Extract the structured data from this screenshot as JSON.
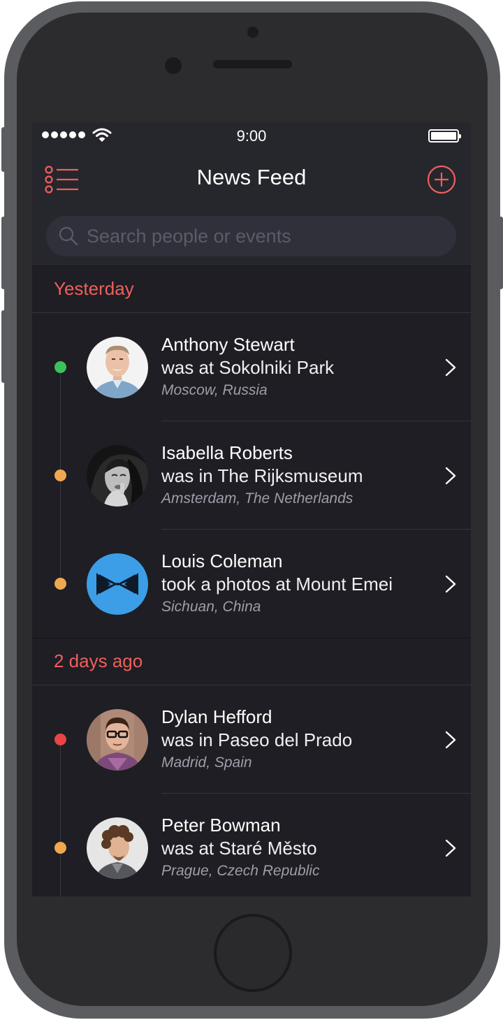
{
  "status_bar": {
    "time": "9:00"
  },
  "nav": {
    "title": "News Feed"
  },
  "search": {
    "placeholder": "Search people or events",
    "value": ""
  },
  "colors": {
    "accent": "#ef5f5c",
    "green": "#3cc25a",
    "orange": "#f0a850",
    "red": "#e84545",
    "background": "#1e1e24"
  },
  "sections": [
    {
      "title": "Yesterday",
      "items": [
        {
          "name": "Anthony Stewart",
          "action": "was at Sokolniki Park",
          "location": "Moscow, Russia",
          "status": "green"
        },
        {
          "name": "Isabella Roberts",
          "action": "was in The Rijksmuseum",
          "location": "Amsterdam, The Netherlands",
          "status": "orange"
        },
        {
          "name": "Louis Coleman",
          "action": "took a photos at Mount Emei",
          "location": "Sichuan, China",
          "status": "orange"
        }
      ]
    },
    {
      "title": "2 days ago",
      "items": [
        {
          "name": "Dylan Hefford",
          "action": "was in Paseo del Prado",
          "location": "Madrid, Spain",
          "status": "red"
        },
        {
          "name": "Peter Bowman",
          "action": "was at Staré Město",
          "location": "Prague, Czech Republic",
          "status": "orange"
        }
      ]
    }
  ]
}
